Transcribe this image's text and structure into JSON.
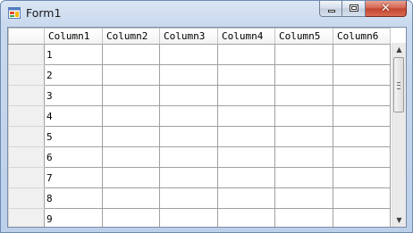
{
  "window": {
    "title": "Form1",
    "icon": "form-app-icon",
    "controls": {
      "minimize_icon": "minimize-icon",
      "maximize_icon": "maximize-icon",
      "close_icon": "close-icon",
      "close_glyph": "✕"
    }
  },
  "grid": {
    "columns": [
      "Column1",
      "Column2",
      "Column3",
      "Column4",
      "Column5",
      "Column6"
    ],
    "rows": [
      [
        "1",
        "",
        "",
        "",
        "",
        ""
      ],
      [
        "2",
        "",
        "",
        "",
        "",
        ""
      ],
      [
        "3",
        "",
        "",
        "",
        "",
        ""
      ],
      [
        "4",
        "",
        "",
        "",
        "",
        ""
      ],
      [
        "5",
        "",
        "",
        "",
        "",
        ""
      ],
      [
        "6",
        "",
        "",
        "",
        "",
        ""
      ],
      [
        "7",
        "",
        "",
        "",
        "",
        ""
      ],
      [
        "8",
        "",
        "",
        "",
        "",
        ""
      ],
      [
        "9",
        "",
        "",
        "",
        "",
        ""
      ]
    ]
  },
  "scrollbar": {
    "up_glyph": "▲",
    "down_glyph": "▼"
  },
  "colors": {
    "titlebar": "#c9d9ee",
    "close_button": "#c2432e",
    "grid_lines": "#a0a0a0",
    "row_header": "#f0f0f0"
  }
}
